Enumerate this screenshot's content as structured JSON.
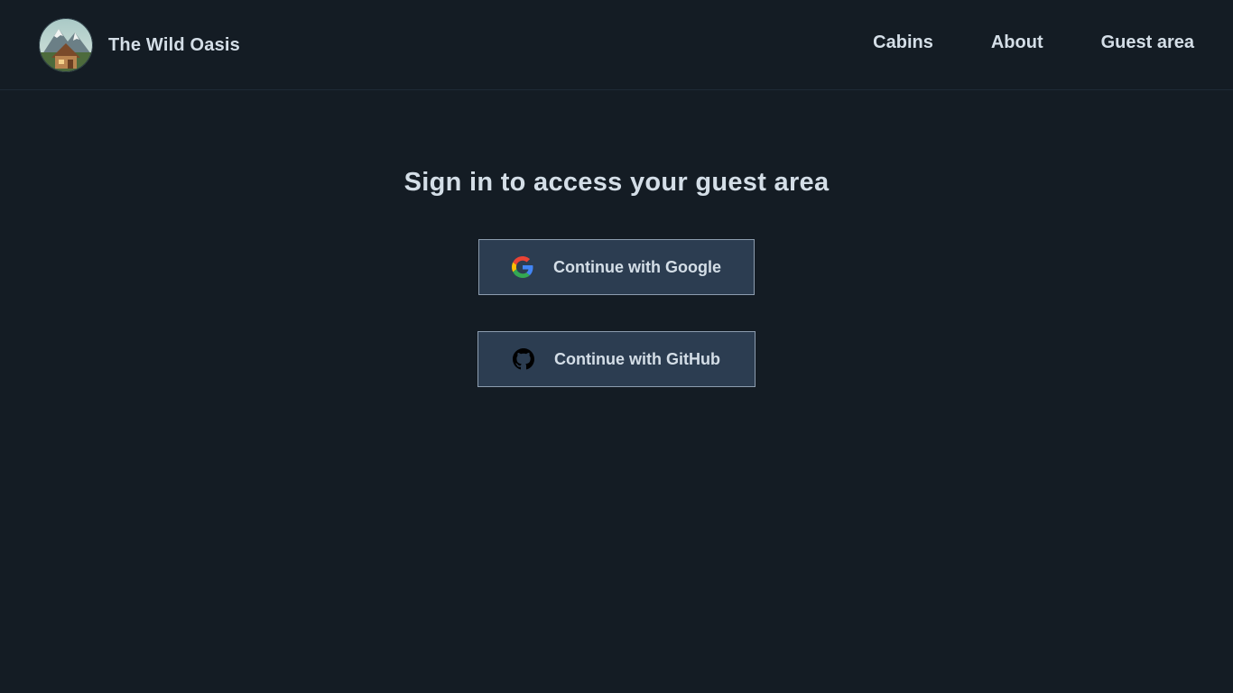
{
  "brand": {
    "name": "The Wild Oasis",
    "logo_icon": "mountain-cabin-logo"
  },
  "nav": {
    "items": [
      {
        "label": "Cabins"
      },
      {
        "label": "About"
      },
      {
        "label": "Guest area"
      }
    ]
  },
  "main": {
    "title": "Sign in to access your guest area",
    "buttons": {
      "google": {
        "label": "Continue with Google",
        "icon": "google-icon"
      },
      "github": {
        "label": "Continue with GitHub",
        "icon": "github-icon"
      }
    }
  },
  "colors": {
    "background": "#141c24",
    "text": "#d4dee7",
    "button_bg": "#2c3d51",
    "button_border": "#8d9daf",
    "header_border": "#1e2a36"
  }
}
